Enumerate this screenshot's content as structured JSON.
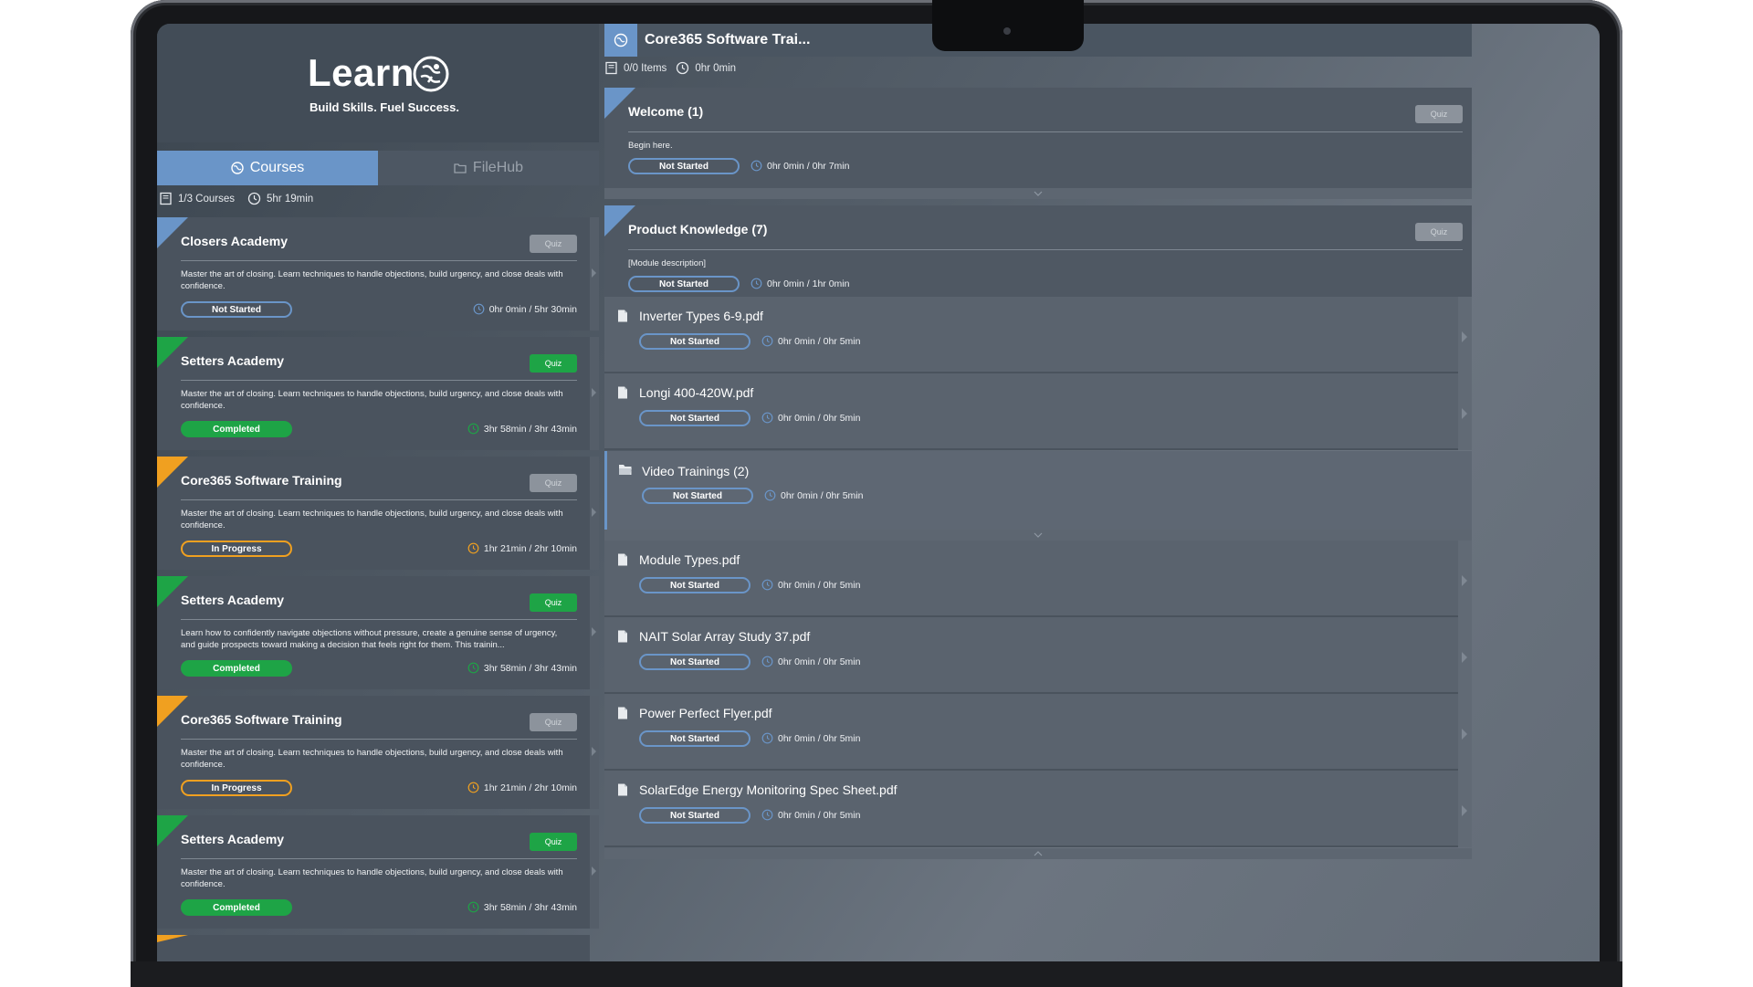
{
  "app": {
    "title": "Learn",
    "tagline": "Build Skills. Fuel Success."
  },
  "colors": {
    "accent_blue": "#6a95c8",
    "green": "#1ea446",
    "orange": "#f0a020"
  },
  "tabs": [
    {
      "label": "Courses",
      "icon": "globe-icon",
      "active": true
    },
    {
      "label": "FileHub",
      "icon": "folder-icon",
      "active": false
    }
  ],
  "left_stats": {
    "courses": "1/3 Courses",
    "time": "5hr 19min"
  },
  "courses": [
    {
      "title": "Closers Academy",
      "quiz": "Quiz",
      "quiz_style": "grey",
      "desc": "Master the art of closing. Learn techniques to handle objections, build urgency, and close deals with confidence.",
      "status": "Not Started",
      "status_style": "ns",
      "time": "0hr 0min / 5hr 30min",
      "flag": "#6a95c8",
      "clock": "#6a95c8"
    },
    {
      "title": "Setters Academy",
      "quiz": "Quiz",
      "quiz_style": "green",
      "desc": "Master the art of closing. Learn techniques to handle objections, build urgency, and close deals with confidence.",
      "status": "Completed",
      "status_style": "done",
      "time": "3hr 58min / 3hr 43min",
      "flag": "#1ea446",
      "clock": "#1ea446"
    },
    {
      "title": "Core365 Software Training",
      "quiz": "Quiz",
      "quiz_style": "grey",
      "desc": "Master the art of closing. Learn techniques to handle objections, build urgency, and close deals with confidence.",
      "status": "In Progress",
      "status_style": "prog",
      "time": "1hr 21min / 2hr 10min",
      "flag": "#f0a020",
      "clock": "#f0a020"
    },
    {
      "title": "Setters Academy",
      "quiz": "Quiz",
      "quiz_style": "green",
      "desc": "Learn how to confidently navigate objections without pressure, create a genuine sense of urgency, and guide prospects toward making a decision that feels right for them. This trainin...",
      "status": "Completed",
      "status_style": "done",
      "time": "3hr 58min / 3hr 43min",
      "flag": "#1ea446",
      "clock": "#1ea446"
    },
    {
      "title": "Core365 Software Training",
      "quiz": "Quiz",
      "quiz_style": "grey",
      "desc": "Master the art of closing. Learn techniques to handle objections, build urgency, and close deals with confidence.",
      "status": "In Progress",
      "status_style": "prog",
      "time": "1hr 21min / 2hr 10min",
      "flag": "#f0a020",
      "clock": "#f0a020"
    },
    {
      "title": "Setters Academy",
      "quiz": "Quiz",
      "quiz_style": "green",
      "desc": "Master the art of closing. Learn techniques to handle objections, build urgency, and close deals with confidence.",
      "status": "Completed",
      "status_style": "done",
      "time": "3hr 58min / 3hr 43min",
      "flag": "#1ea446",
      "clock": "#1ea446"
    }
  ],
  "course_detail": {
    "title": "Core365 Software Trai...",
    "items_count": "0/0 Items",
    "time": "0hr 0min",
    "modules": [
      {
        "title": "Welcome (1)",
        "quiz": "Quiz",
        "desc": "Begin here.",
        "status": "Not Started",
        "time": "0hr 0min / 0hr 7min"
      },
      {
        "title": "Product Knowledge (7)",
        "quiz": "Quiz",
        "desc": "[Module description]",
        "status": "Not Started",
        "time": "0hr 0min / 1hr 0min"
      }
    ],
    "items_a": [
      {
        "name": "Inverter Types 6-9.pdf",
        "status": "Not Started",
        "time": "0hr 0min / 0hr 5min"
      },
      {
        "name": "Longi 400-420W.pdf",
        "status": "Not Started",
        "time": "0hr 0min / 0hr 5min"
      }
    ],
    "folder": {
      "name": "Video Trainings (2)",
      "status": "Not Started",
      "time": "0hr 0min / 0hr 5min"
    },
    "items_b": [
      {
        "name": "Module Types.pdf",
        "status": "Not Started",
        "time": "0hr 0min / 0hr 5min"
      },
      {
        "name": "NAIT Solar Array Study 37.pdf",
        "status": "Not Started",
        "time": "0hr 0min / 0hr 5min"
      },
      {
        "name": "Power Perfect Flyer.pdf",
        "status": "Not Started",
        "time": "0hr 0min / 0hr 5min"
      },
      {
        "name": "SolarEdge Energy Monitoring Spec Sheet.pdf",
        "status": "Not Started",
        "time": "0hr 0min / 0hr 5min"
      }
    ]
  }
}
